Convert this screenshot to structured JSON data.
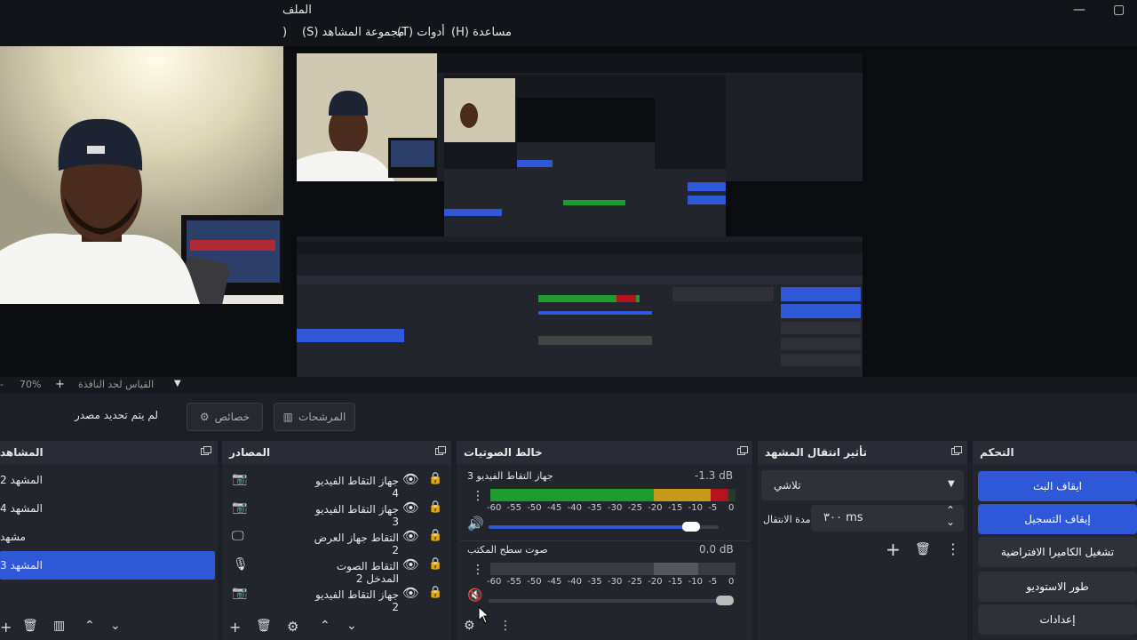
{
  "window": {
    "title": "الملف",
    "min": "—",
    "max": "▢"
  },
  "menu": {
    "scene_collection": "(S) مجموعة المشاهد",
    "tools": "(T) أدوات",
    "help": "(H) مساعدة",
    "paren": ")"
  },
  "zoom": {
    "value": "70%",
    "plus": "+",
    "minus": "-",
    "fit_label": "القياس لحد النافذة",
    "chevron": "▼"
  },
  "props": {
    "no_source": "لم يتم تحديد مصدر",
    "properties": "خصائص",
    "filters": "المرشحات"
  },
  "scenes": {
    "title": "المشاهد",
    "items": [
      {
        "label": "المشهد 2"
      },
      {
        "label": "المشهد 4"
      },
      {
        "label": "مشهد"
      },
      {
        "label": "المشهد 3",
        "selected": true
      }
    ]
  },
  "sources": {
    "title": "المصادر",
    "items": [
      {
        "label": "جهاز التقاط الفيديو 4",
        "icon": "camera-icon"
      },
      {
        "label": "جهاز التقاط الفيديو 3",
        "icon": "camera-icon"
      },
      {
        "label": "التقاط جهاز العرض 2",
        "icon": "monitor-icon"
      },
      {
        "label": "التقاط الصوت المدخل 2",
        "icon": "microphone-icon"
      },
      {
        "label": "جهاز التقاط الفيديو 2",
        "icon": "camera-icon"
      }
    ]
  },
  "mixer": {
    "title": "خالط الصوتيات",
    "channels": [
      {
        "name": "جهاز التقاط الفيديو 3",
        "db": "-1.3 dB",
        "level": 0.97,
        "volume": 0.88,
        "muted": false
      },
      {
        "name": "صوت سطح المكتب",
        "db": "0.0 dB",
        "level": 0.0,
        "volume": 0.95,
        "muted": true
      }
    ],
    "ticks": [
      "-60",
      "-55",
      "-50",
      "-45",
      "-40",
      "-35",
      "-30",
      "-25",
      "-20",
      "-15",
      "-10",
      "-5",
      "0"
    ]
  },
  "transitions": {
    "title": "تأثير انتقال المشهد",
    "selected": "تلاشي",
    "duration_label": "مدة الانتقال",
    "duration_value": "٣٠٠ ms"
  },
  "controls": {
    "title": "التحكم",
    "stop_stream": "ايقاف البث",
    "stop_recording": "إيقاف التسجيل",
    "virtual_camera": "تشغيل الكاميرا الافتراضية",
    "studio_mode": "طور الاستوديو",
    "settings": "إعدادات"
  },
  "colors": {
    "accent": "#2f58d8",
    "panel": "#23252d",
    "header": "#2a2c35",
    "meter_green": "#1e9b2e",
    "meter_yellow": "#c99a1a",
    "meter_red": "#b4121f"
  }
}
